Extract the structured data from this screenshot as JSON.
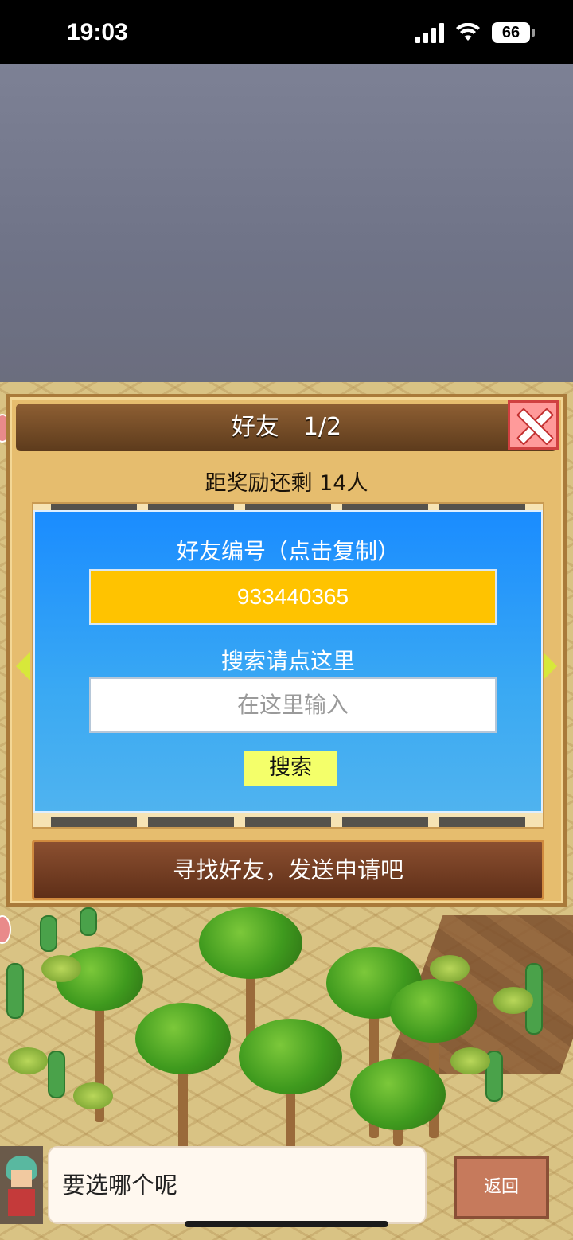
{
  "status_bar": {
    "time": "19:03",
    "battery": "66"
  },
  "dialog": {
    "title": "好友　1/2",
    "reward_text": "距奖励还剩 14人",
    "friend_id_label": "好友编号（点击复制）",
    "friend_id": "933440365",
    "search_label": "搜索请点这里",
    "search_placeholder": "在这里输入",
    "search_button": "搜索",
    "banner": "寻找好友，发送申请吧"
  },
  "bottom": {
    "speech": "要选哪个呢",
    "back_button": "返回"
  },
  "colors": {
    "panel_blue": "#1a8cff",
    "friend_id_bg": "#ffc300",
    "search_button_bg": "#f4ff6a",
    "close_button": "#ff9a9a"
  },
  "icons": [
    "signal-icon",
    "wifi-icon",
    "battery-icon",
    "close-icon",
    "left-arrow-icon",
    "right-arrow-icon"
  ]
}
